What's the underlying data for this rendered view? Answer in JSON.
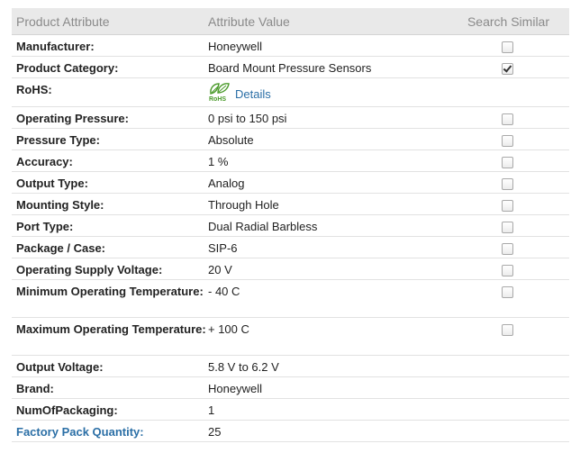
{
  "headers": {
    "attribute": "Product Attribute",
    "value": "Attribute Value",
    "search": "Search Similar"
  },
  "rows": [
    {
      "label": "Manufacturer:",
      "value": "Honeywell",
      "checked": false
    },
    {
      "label": "Product Category:",
      "value": "Board Mount Pressure Sensors",
      "checked": true
    },
    {
      "label": "RoHS:",
      "value": "Details",
      "rohs_text": "RoHS",
      "icon": "rohs-leaf-icon"
    },
    {
      "label": "Operating Pressure:",
      "value": "0 psi to 150 psi",
      "checked": false
    },
    {
      "label": "Pressure Type:",
      "value": "Absolute",
      "checked": false
    },
    {
      "label": "Accuracy:",
      "value": "1 %",
      "checked": false
    },
    {
      "label": "Output Type:",
      "value": "Analog",
      "checked": false
    },
    {
      "label": "Mounting Style:",
      "value": "Through Hole",
      "checked": false
    },
    {
      "label": "Port Type:",
      "value": "Dual Radial Barbless",
      "checked": false
    },
    {
      "label": "Package / Case:",
      "value": "SIP-6",
      "checked": false
    },
    {
      "label": "Operating Supply Voltage:",
      "value": "20 V",
      "checked": false
    },
    {
      "label": "Minimum Operating Temperature:",
      "value": "- 40 C",
      "checked": false
    },
    {
      "label": "Maximum Operating Temperature:",
      "value": "+ 100 C",
      "checked": false
    },
    {
      "label": "Output Voltage:",
      "value": "5.8 V to 6.2 V"
    },
    {
      "label": "Brand:",
      "value": "Honeywell"
    },
    {
      "label": "NumOfPackaging:",
      "value": "1"
    },
    {
      "label": "Factory Pack Quantity:",
      "value": "25",
      "link": true
    }
  ],
  "colors": {
    "link": "#2b6fa6",
    "header_bg": "#e9e9e9",
    "header_text": "#8a8a8a",
    "rohs_green": "#4a9a2a"
  }
}
